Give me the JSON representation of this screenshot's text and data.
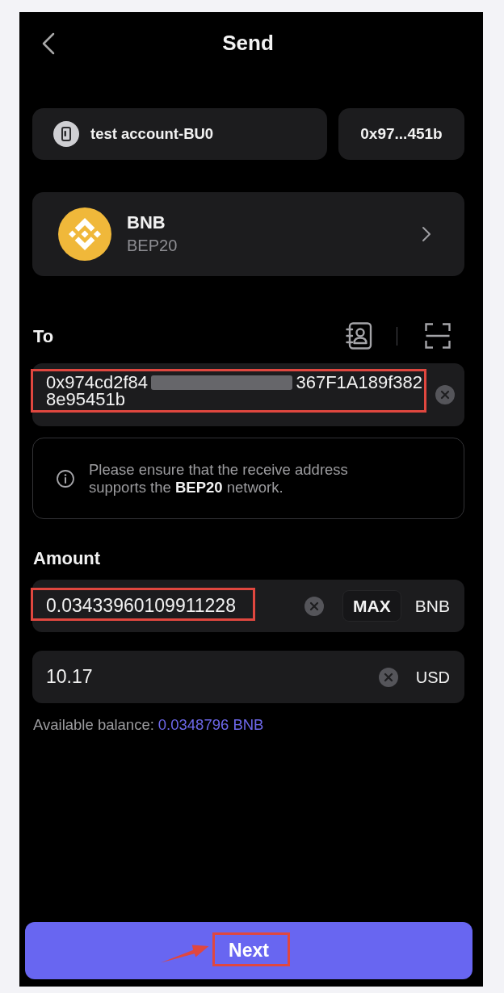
{
  "header": {
    "title": "Send"
  },
  "account": {
    "name": "test account-BU0",
    "address_short": "0x97...451b"
  },
  "token": {
    "symbol": "BNB",
    "network": "BEP20"
  },
  "recipient": {
    "label": "To",
    "address_start": "0x974cd2f84",
    "redacted": true,
    "address_end": "367F1A189f382",
    "address_line_2": "8e95451b",
    "highlighted": true
  },
  "notice": {
    "text": "Please ensure that the receive address supports the **BEP20** network."
  },
  "amount": {
    "label": "Amount",
    "value": "0.03433960109911228",
    "highlighted": true,
    "max_button": "MAX",
    "unit": "BNB"
  },
  "fiat": {
    "value": "10.17",
    "unit": "USD"
  },
  "balance": {
    "label": "Available balance:",
    "value": "0.0348796 BNB"
  },
  "next_button": {
    "label": "Next",
    "highlighted": true,
    "arrow": true
  }
}
